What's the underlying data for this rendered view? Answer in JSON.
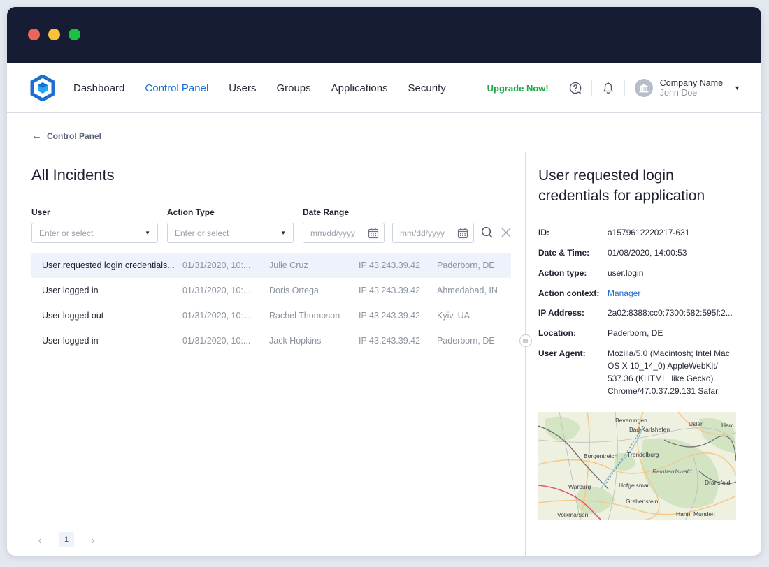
{
  "nav": {
    "items": [
      {
        "label": "Dashboard",
        "active": false
      },
      {
        "label": "Control Panel",
        "active": true
      },
      {
        "label": "Users",
        "active": false
      },
      {
        "label": "Groups",
        "active": false
      },
      {
        "label": "Applications",
        "active": false
      },
      {
        "label": "Security",
        "active": false
      }
    ],
    "upgrade_label": "Upgrade Now!",
    "account": {
      "company": "Company Name",
      "user": "John Doe"
    }
  },
  "colors": {
    "accent": "#1f6fd1",
    "upgrade": "#1ea84a",
    "titlebar": "#161c34",
    "selected_row": "#eef3fb"
  },
  "breadcrumb": {
    "back_label": "Control Panel"
  },
  "page": {
    "title": "All Incidents"
  },
  "filters": {
    "user": {
      "label": "User",
      "placeholder": "Enter or select"
    },
    "action_type": {
      "label": "Action Type",
      "placeholder": "Enter or select"
    },
    "date_range": {
      "label": "Date Range",
      "from_placeholder": "mm/dd/yyyy",
      "to_placeholder": "mm/dd/yyyy",
      "separator": "-"
    }
  },
  "incidents": [
    {
      "action": "User requested login credentials...",
      "time": "01/31/2020, 10:...",
      "user": "Julie Cruz",
      "ip": "IP 43.243.39.42",
      "location": "Paderborn, DE",
      "selected": true
    },
    {
      "action": "User logged in",
      "time": "01/31/2020, 10:...",
      "user": "Doris Ortega",
      "ip": "IP 43.243.39.42",
      "location": "Ahmedabad, IN",
      "selected": false
    },
    {
      "action": "User logged out",
      "time": "01/31/2020, 10:...",
      "user": "Rachel Thompson",
      "ip": "IP 43.243.39.42",
      "location": "Kyiv, UA",
      "selected": false
    },
    {
      "action": "User logged in",
      "time": "01/31/2020, 10:...",
      "user": "Jack Hopkins",
      "ip": "IP 43.243.39.42",
      "location": "Paderborn, DE",
      "selected": false
    }
  ],
  "pagination": {
    "prev": "‹",
    "current": "1",
    "next": "›"
  },
  "detail": {
    "title": "User requested login credentials for application",
    "fields": [
      {
        "key": "ID:",
        "value": "a1579612220217-631"
      },
      {
        "key": "Date & Time:",
        "value": "01/08/2020, 14:00:53"
      },
      {
        "key": "Action type:",
        "value": "user.login"
      },
      {
        "key": "Action context:",
        "value": "Manager"
      },
      {
        "key": "IP Address:",
        "value": "2a02:8388:cc0:7300:582:595f:2..."
      },
      {
        "key": "Location:",
        "value": "Paderborn, DE"
      },
      {
        "key": "User Agent:",
        "value": "Mozilla/5.0 (Macintosh; Intel Mac OS X 10_14_0) AppleWebKit/ 537.36 (KHTML, like Gecko) Chrome/47.0.37.29.131 Safari"
      }
    ],
    "map_labels": [
      "Beverungen",
      "Bad Karlshafen",
      "Uslar",
      "Harc",
      "Borgentreich",
      "Trendelburg",
      "Reinhardswald",
      "Dransfeld",
      "Warburg",
      "Hofgeismar",
      "Grebenstein",
      "Volkmarsen",
      "Hann. Munden"
    ]
  }
}
